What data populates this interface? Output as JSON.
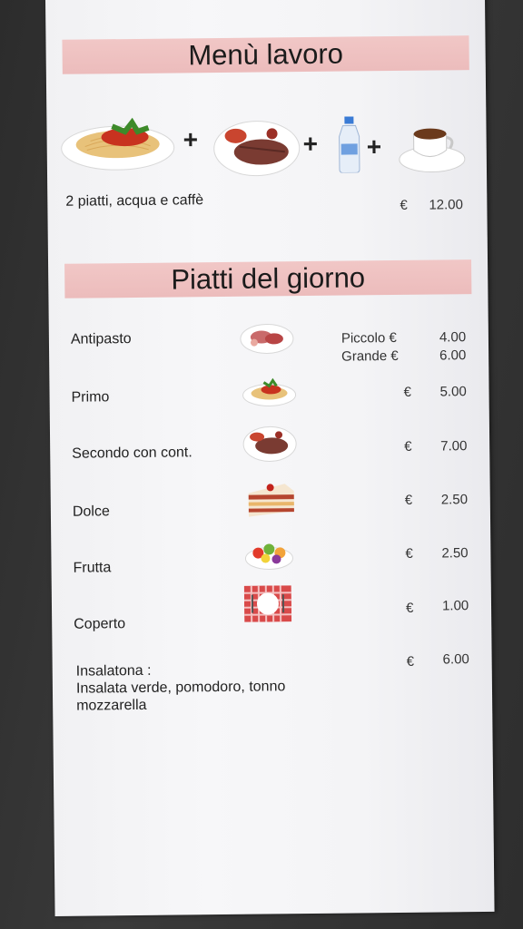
{
  "menu_lavoro": {
    "title": "Menù lavoro",
    "plus_symbol": "+",
    "description": "2 piatti, acqua e caffè",
    "currency": "€",
    "price": "12.00",
    "icons": [
      "spaghetti-plate-icon",
      "steak-plate-icon",
      "water-bottle-icon",
      "espresso-cup-icon"
    ]
  },
  "piatti_del_giorno": {
    "title": "Piatti del giorno",
    "items": [
      {
        "name": "Antipasto",
        "icon": "antipasto-plate-icon",
        "prices": [
          {
            "label": "Piccolo €",
            "value": "4.00"
          },
          {
            "label": "Grande €",
            "value": "6.00"
          }
        ]
      },
      {
        "name": "Primo",
        "icon": "pasta-plate-icon",
        "currency": "€",
        "value": "5.00"
      },
      {
        "name": "Secondo con cont.",
        "icon": "meat-plate-icon",
        "currency": "€",
        "value": "7.00"
      },
      {
        "name": "Dolce",
        "icon": "cake-slice-icon",
        "currency": "€",
        "value": "2.50"
      },
      {
        "name": "Frutta",
        "icon": "fruit-bowl-icon",
        "currency": "€",
        "value": "2.50"
      },
      {
        "name": "Coperto",
        "icon": "place-setting-icon",
        "currency": "€",
        "value": "1.00"
      },
      {
        "name": "Insalatona :",
        "name_line2": "Insalata verde, pomodoro, tonno",
        "name_line3": "mozzarella",
        "currency": "€",
        "value": "6.00"
      }
    ]
  },
  "colors": {
    "banner": "#efc2c2",
    "paper": "#f5f5f7",
    "background": "#333333"
  }
}
